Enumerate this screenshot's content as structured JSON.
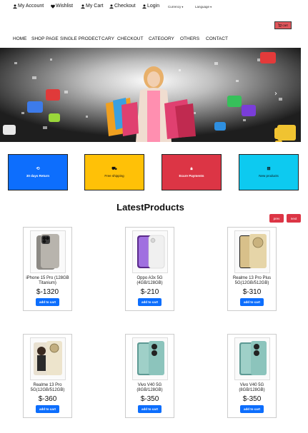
{
  "topbar": {
    "account": "My Account",
    "wishlist": "Wishlist",
    "cart": "My Cart",
    "checkout": "Checkout",
    "login": "Login",
    "currency": "Currency",
    "language": "Language"
  },
  "header": {
    "cart_button": "cart"
  },
  "nav": [
    "HOME",
    "SHOP PAGE",
    "SINGLE PRODECT",
    "CARY",
    "CHECKOUT",
    "CATEGORY",
    "OTHERS",
    "CONTACT"
  ],
  "features": [
    {
      "icon": "refresh-icon",
      "label": "30 days Return",
      "color": "#0d6efd"
    },
    {
      "icon": "truck-icon",
      "label": "Free shipping",
      "color": "#ffc107"
    },
    {
      "icon": "lock-icon",
      "label": "Ecure Payments",
      "color": "#dc3545"
    },
    {
      "icon": "gift-icon",
      "label": "New products",
      "color": "#0dcaf0"
    }
  ],
  "section_title": "LatestProducts",
  "pager": {
    "prev": "prev",
    "next": "next"
  },
  "products": [
    {
      "name": "iPhone 15 Pro (128GB Titanium)",
      "price": "$-1320",
      "button": "add to cart"
    },
    {
      "name": "Oppo A3x 5G (4GB/128GB)",
      "price": "$-210",
      "button": "add to cart"
    },
    {
      "name": "Realme 13 Pro Plus 5G(12GB/512GB)",
      "price": "$-310",
      "button": "add to cart"
    },
    {
      "name": "Realme 13 Pro 5G(12GB/512GB)",
      "price": "$-360",
      "button": "add to cart"
    },
    {
      "name": "Vivo V40 5G (8GB/128GB)",
      "price": "$-350",
      "button": "add to cart"
    },
    {
      "name": "Vivo V40 5G (8GB/128GB)",
      "price": "$-350",
      "button": "add to cart"
    }
  ],
  "colors": {
    "primary": "#0d6efd",
    "warning": "#ffc107",
    "danger": "#dc3545",
    "info": "#0dcaf0"
  }
}
